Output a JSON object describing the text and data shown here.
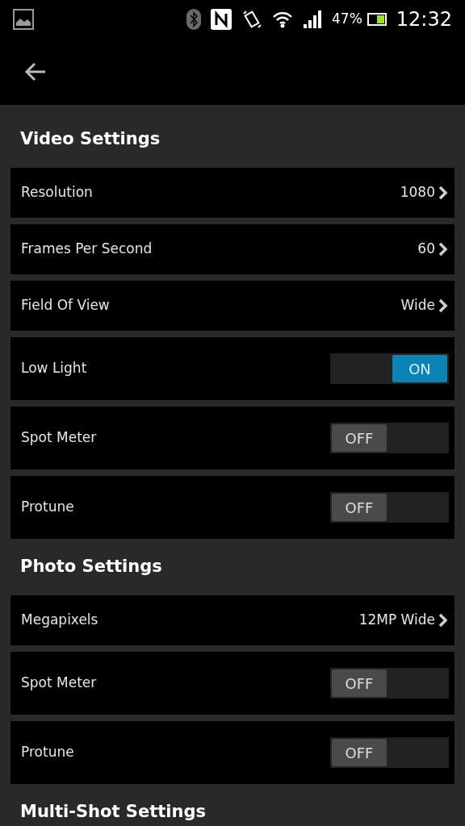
{
  "status_bar": {
    "battery": "47%",
    "time": "12:32"
  },
  "sections": [
    {
      "title": "Video Settings",
      "items": [
        {
          "kind": "value",
          "label": "Resolution",
          "value": "1080"
        },
        {
          "kind": "value",
          "label": "Frames Per Second",
          "value": "60"
        },
        {
          "kind": "value",
          "label": "Field Of View",
          "value": "Wide"
        },
        {
          "kind": "toggle",
          "label": "Low Light",
          "on": true,
          "state_text": "ON"
        },
        {
          "kind": "toggle",
          "label": "Spot Meter",
          "on": false,
          "state_text": "OFF"
        },
        {
          "kind": "toggle",
          "label": "Protune",
          "on": false,
          "state_text": "OFF"
        }
      ]
    },
    {
      "title": "Photo Settings",
      "items": [
        {
          "kind": "value",
          "label": "Megapixels",
          "value": "12MP Wide"
        },
        {
          "kind": "toggle",
          "label": "Spot Meter",
          "on": false,
          "state_text": "OFF"
        },
        {
          "kind": "toggle",
          "label": "Protune",
          "on": false,
          "state_text": "OFF"
        }
      ]
    },
    {
      "title": "Multi-Shot Settings"
    }
  ]
}
